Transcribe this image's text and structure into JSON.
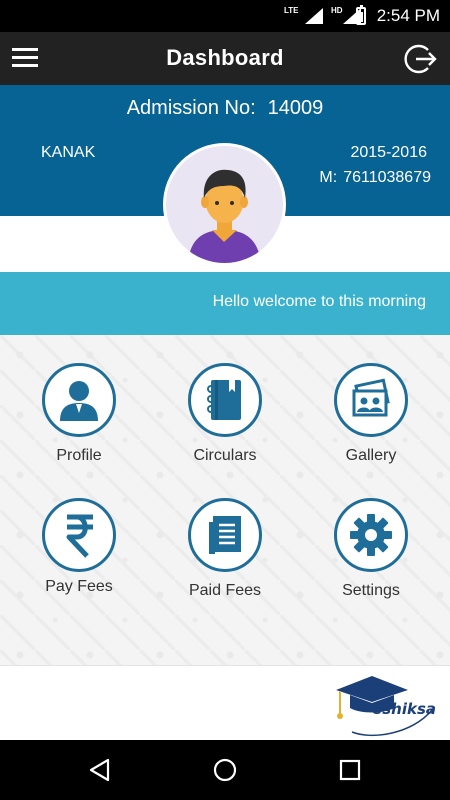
{
  "status_bar": {
    "time": "2:54 PM",
    "network_label": "LTE",
    "hd_label": "HD"
  },
  "app_bar": {
    "title": "Dashboard",
    "menu_icon": "hamburger-menu-icon",
    "logout_icon": "logout-icon"
  },
  "student": {
    "admission_label": "Admission No:",
    "admission_number": "14009",
    "name": "KANAK",
    "session": "2015-2016",
    "mobile_label": "M:",
    "mobile": "7611038679"
  },
  "greeting": "Hello welcome to this morning",
  "menu": {
    "profile": "Profile",
    "circulars": "Circulars",
    "gallery": "Gallery",
    "pay_fees": "Pay Fees",
    "paid_fees": "Paid Fees",
    "settings": "Settings"
  },
  "footer": {
    "logo_text": "eshiksa"
  },
  "colors": {
    "app_bar": "#222222",
    "header": "#066393",
    "greeting": "#3ab2cd",
    "icon_accent": "#1f6e9a"
  }
}
